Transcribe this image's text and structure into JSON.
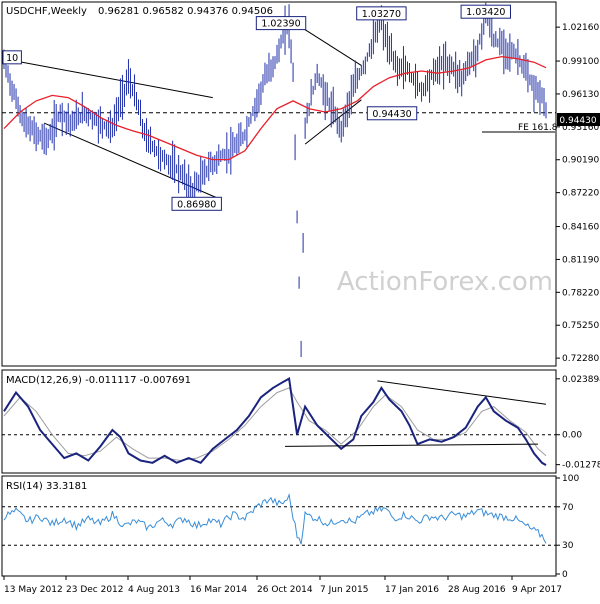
{
  "header": {
    "symbol": "USDCHF,Weekly",
    "ohlc": "0.96281 0.96582 0.94376 0.94506"
  },
  "watermark": "ActionForex.com",
  "colors": {
    "price": "#1f2fa8",
    "sma": "#e8202a",
    "macd": "#1a237e",
    "signal": "#9e9e9e",
    "rsi": "#3a8ed8",
    "label_box": "#1a237e",
    "trendline": "#000000"
  },
  "chart_data": [
    {
      "type": "line",
      "title": "USDCHF,Weekly",
      "x": [
        "13 May 2012",
        "23 Dec 2012",
        "4 Aug 2013",
        "16 Mar 2014",
        "26 Oct 2014",
        "7 Jun 2015",
        "17 Jan 2016",
        "28 Aug 2016",
        "9 Apr 2017"
      ],
      "ylim": [
        0.7175,
        1.0425
      ],
      "yticks": [
        "1.02160",
        "0.99100",
        "0.96130",
        "0.93160",
        "0.90190",
        "0.87220",
        "0.84160",
        "0.81190",
        "0.78220",
        "0.75250",
        "0.72280"
      ],
      "price_path": [
        [
          0,
          0.99
        ],
        [
          3,
          0.955
        ],
        [
          5,
          0.935
        ],
        [
          8,
          0.925
        ],
        [
          11,
          0.92
        ],
        [
          14,
          0.945
        ],
        [
          17,
          0.935
        ],
        [
          20,
          0.945
        ],
        [
          24,
          0.935
        ],
        [
          27,
          0.93
        ],
        [
          29,
          0.955
        ],
        [
          31,
          0.975
        ],
        [
          33,
          0.955
        ],
        [
          35,
          0.925
        ],
        [
          37,
          0.915
        ],
        [
          39,
          0.905
        ],
        [
          41,
          0.9
        ],
        [
          44,
          0.89
        ],
        [
          47,
          0.875
        ],
        [
          49,
          0.885
        ],
        [
          51,
          0.895
        ],
        [
          54,
          0.905
        ],
        [
          57,
          0.91
        ],
        [
          60,
          0.925
        ],
        [
          63,
          0.955
        ],
        [
          65,
          0.975
        ],
        [
          68,
          0.995
        ],
        [
          70,
          1.02
        ],
        [
          71,
          1.0239
        ],
        [
          72,
          0.98
        ],
        [
          73,
          0.85
        ],
        [
          74,
          0.73
        ],
        [
          75,
          0.93
        ],
        [
          76,
          0.95
        ],
        [
          78,
          0.98
        ],
        [
          80,
          0.96
        ],
        [
          82,
          0.945
        ],
        [
          84,
          0.93
        ],
        [
          86,
          0.955
        ],
        [
          88,
          0.975
        ],
        [
          90,
          0.99
        ],
        [
          92,
          1.01
        ],
        [
          94,
          1.027
        ],
        [
          96,
          1.0
        ],
        [
          98,
          0.985
        ],
        [
          100,
          0.985
        ],
        [
          102,
          0.975
        ],
        [
          104,
          0.965
        ],
        [
          106,
          0.975
        ],
        [
          108,
          0.985
        ],
        [
          110,
          0.99
        ],
        [
          112,
          0.985
        ],
        [
          114,
          0.975
        ],
        [
          116,
          0.99
        ],
        [
          118,
          1.0
        ],
        [
          120,
          1.034
        ],
        [
          122,
          1.01
        ],
        [
          124,
          1.005
        ],
        [
          126,
          1.0
        ],
        [
          128,
          0.995
        ],
        [
          130,
          0.98
        ],
        [
          132,
          0.965
        ],
        [
          134,
          0.96
        ],
        [
          135,
          0.945
        ]
      ],
      "sma_path": [
        [
          0,
          0.93
        ],
        [
          4,
          0.945
        ],
        [
          8,
          0.955
        ],
        [
          12,
          0.96
        ],
        [
          16,
          0.958
        ],
        [
          20,
          0.95
        ],
        [
          24,
          0.94
        ],
        [
          28,
          0.933
        ],
        [
          32,
          0.928
        ],
        [
          36,
          0.924
        ],
        [
          40,
          0.918
        ],
        [
          44,
          0.912
        ],
        [
          48,
          0.906
        ],
        [
          52,
          0.902
        ],
        [
          56,
          0.902
        ],
        [
          60,
          0.91
        ],
        [
          64,
          0.93
        ],
        [
          68,
          0.948
        ],
        [
          72,
          0.955
        ],
        [
          76,
          0.948
        ],
        [
          80,
          0.945
        ],
        [
          84,
          0.948
        ],
        [
          88,
          0.955
        ],
        [
          92,
          0.968
        ],
        [
          96,
          0.976
        ],
        [
          100,
          0.98
        ],
        [
          104,
          0.982
        ],
        [
          108,
          0.98
        ],
        [
          112,
          0.982
        ],
        [
          116,
          0.985
        ],
        [
          120,
          0.992
        ],
        [
          124,
          0.995
        ],
        [
          128,
          0.993
        ],
        [
          132,
          0.99
        ],
        [
          135,
          0.985
        ]
      ],
      "callouts": [
        {
          "text": "10",
          "at": [
            0,
            0.993
          ]
        },
        {
          "text": "0.86980",
          "at": [
            48,
            0.8698
          ]
        },
        {
          "text": "1.02390",
          "at": [
            69,
            1.0239
          ]
        },
        {
          "text": "1.03270",
          "at": [
            94,
            1.0327
          ]
        },
        {
          "text": "1.03420",
          "at": [
            120,
            1.0342
          ]
        },
        {
          "text": "0.94430",
          "at": [
            90,
            0.9443
          ]
        }
      ],
      "horizontal_line": {
        "value": 0.9443,
        "label": "0.94430"
      },
      "fe_label": "FE 161.8",
      "trendlines": [
        {
          "from": [
            0,
            0.993
          ],
          "to": [
            52,
            0.958
          ]
        },
        {
          "from": [
            10,
            0.935
          ],
          "to": [
            54,
            0.866
          ]
        },
        {
          "from": [
            73,
            1.0239
          ],
          "to": [
            89,
            0.987
          ]
        },
        {
          "from": [
            75,
            0.916
          ],
          "to": [
            89,
            0.956
          ]
        }
      ]
    },
    {
      "type": "line",
      "title": "MACD(12,26,9) -0.011117 -0.007691",
      "ylim": [
        -0.0155,
        0.0268
      ],
      "yticks": [
        "0.023894",
        "0.00",
        "-0.012784"
      ],
      "macd_path": [
        [
          0,
          0.01
        ],
        [
          3,
          0.018
        ],
        [
          6,
          0.012
        ],
        [
          9,
          0.002
        ],
        [
          12,
          -0.004
        ],
        [
          15,
          -0.01
        ],
        [
          18,
          -0.008
        ],
        [
          21,
          -0.011
        ],
        [
          24,
          -0.005
        ],
        [
          27,
          0.002
        ],
        [
          29,
          -0.001
        ],
        [
          31,
          -0.008
        ],
        [
          34,
          -0.011
        ],
        [
          37,
          -0.012
        ],
        [
          40,
          -0.009
        ],
        [
          43,
          -0.012
        ],
        [
          46,
          -0.01
        ],
        [
          49,
          -0.012
        ],
        [
          52,
          -0.006
        ],
        [
          55,
          -0.002
        ],
        [
          58,
          0.002
        ],
        [
          61,
          0.008
        ],
        [
          64,
          0.016
        ],
        [
          67,
          0.02
        ],
        [
          69,
          0.022
        ],
        [
          71,
          0.024
        ],
        [
          72,
          0.012
        ],
        [
          73,
          0.0
        ],
        [
          75,
          0.012
        ],
        [
          78,
          0.004
        ],
        [
          81,
          -0.001
        ],
        [
          84,
          -0.006
        ],
        [
          87,
          -0.002
        ],
        [
          89,
          0.008
        ],
        [
          92,
          0.014
        ],
        [
          94,
          0.02
        ],
        [
          96,
          0.015
        ],
        [
          99,
          0.01
        ],
        [
          101,
          0.004
        ],
        [
          103,
          -0.004
        ],
        [
          106,
          -0.002
        ],
        [
          109,
          -0.003
        ],
        [
          112,
          -0.001
        ],
        [
          115,
          0.003
        ],
        [
          118,
          0.012
        ],
        [
          120,
          0.016
        ],
        [
          122,
          0.01
        ],
        [
          125,
          0.006
        ],
        [
          128,
          0.003
        ],
        [
          130,
          -0.002
        ],
        [
          132,
          -0.008
        ],
        [
          134,
          -0.012
        ],
        [
          135,
          -0.013
        ]
      ],
      "signal_path": [
        [
          0,
          0.008
        ],
        [
          4,
          0.016
        ],
        [
          8,
          0.01
        ],
        [
          12,
          0.0
        ],
        [
          16,
          -0.008
        ],
        [
          20,
          -0.009
        ],
        [
          24,
          -0.007
        ],
        [
          28,
          -0.001
        ],
        [
          32,
          -0.006
        ],
        [
          36,
          -0.01
        ],
        [
          40,
          -0.01
        ],
        [
          44,
          -0.011
        ],
        [
          48,
          -0.01
        ],
        [
          52,
          -0.007
        ],
        [
          56,
          -0.002
        ],
        [
          60,
          0.004
        ],
        [
          64,
          0.012
        ],
        [
          68,
          0.018
        ],
        [
          71,
          0.02
        ],
        [
          73,
          0.014
        ],
        [
          76,
          0.006
        ],
        [
          80,
          0.002
        ],
        [
          84,
          -0.004
        ],
        [
          88,
          0.002
        ],
        [
          92,
          0.012
        ],
        [
          95,
          0.017
        ],
        [
          99,
          0.012
        ],
        [
          103,
          0.002
        ],
        [
          107,
          -0.002
        ],
        [
          111,
          -0.002
        ],
        [
          115,
          0.001
        ],
        [
          119,
          0.01
        ],
        [
          122,
          0.012
        ],
        [
          126,
          0.006
        ],
        [
          130,
          0.001
        ],
        [
          133,
          -0.006
        ],
        [
          135,
          -0.009
        ]
      ],
      "trendlines": [
        {
          "from": [
            93,
            0.023
          ],
          "to": [
            135,
            0.013
          ]
        },
        {
          "from": [
            70,
            -0.005
          ],
          "to": [
            133,
            -0.004
          ]
        }
      ]
    },
    {
      "type": "line",
      "title": "RSI(14) 33.3181",
      "ylim": [
        0,
        100
      ],
      "yticks": [
        "100",
        "70",
        "30",
        "0"
      ],
      "rsi_path": [
        [
          0,
          60
        ],
        [
          3,
          65
        ],
        [
          6,
          55
        ],
        [
          9,
          60
        ],
        [
          12,
          52
        ],
        [
          15,
          58
        ],
        [
          18,
          50
        ],
        [
          21,
          57
        ],
        [
          24,
          52
        ],
        [
          27,
          62
        ],
        [
          30,
          50
        ],
        [
          33,
          55
        ],
        [
          36,
          48
        ],
        [
          39,
          56
        ],
        [
          42,
          52
        ],
        [
          45,
          58
        ],
        [
          48,
          50
        ],
        [
          51,
          56
        ],
        [
          54,
          52
        ],
        [
          57,
          62
        ],
        [
          60,
          58
        ],
        [
          63,
          70
        ],
        [
          66,
          78
        ],
        [
          69,
          72
        ],
        [
          71,
          80
        ],
        [
          73,
          40
        ],
        [
          74,
          35
        ],
        [
          75,
          62
        ],
        [
          78,
          58
        ],
        [
          81,
          52
        ],
        [
          84,
          58
        ],
        [
          87,
          54
        ],
        [
          90,
          62
        ],
        [
          93,
          66
        ],
        [
          95,
          68
        ],
        [
          97,
          58
        ],
        [
          100,
          62
        ],
        [
          103,
          55
        ],
        [
          106,
          60
        ],
        [
          109,
          58
        ],
        [
          112,
          62
        ],
        [
          115,
          60
        ],
        [
          118,
          66
        ],
        [
          121,
          62
        ],
        [
          124,
          60
        ],
        [
          127,
          58
        ],
        [
          130,
          50
        ],
        [
          132,
          45
        ],
        [
          134,
          40
        ],
        [
          135,
          35
        ]
      ]
    }
  ],
  "x_axis_labels": [
    "13 May 2012",
    "23 Dec 2012",
    "4 Aug 2013",
    "16 Mar 2014",
    "26 Oct 2014",
    "7 Jun 2015",
    "17 Jan 2016",
    "28 Aug 2016",
    "9 Apr 2017"
  ]
}
